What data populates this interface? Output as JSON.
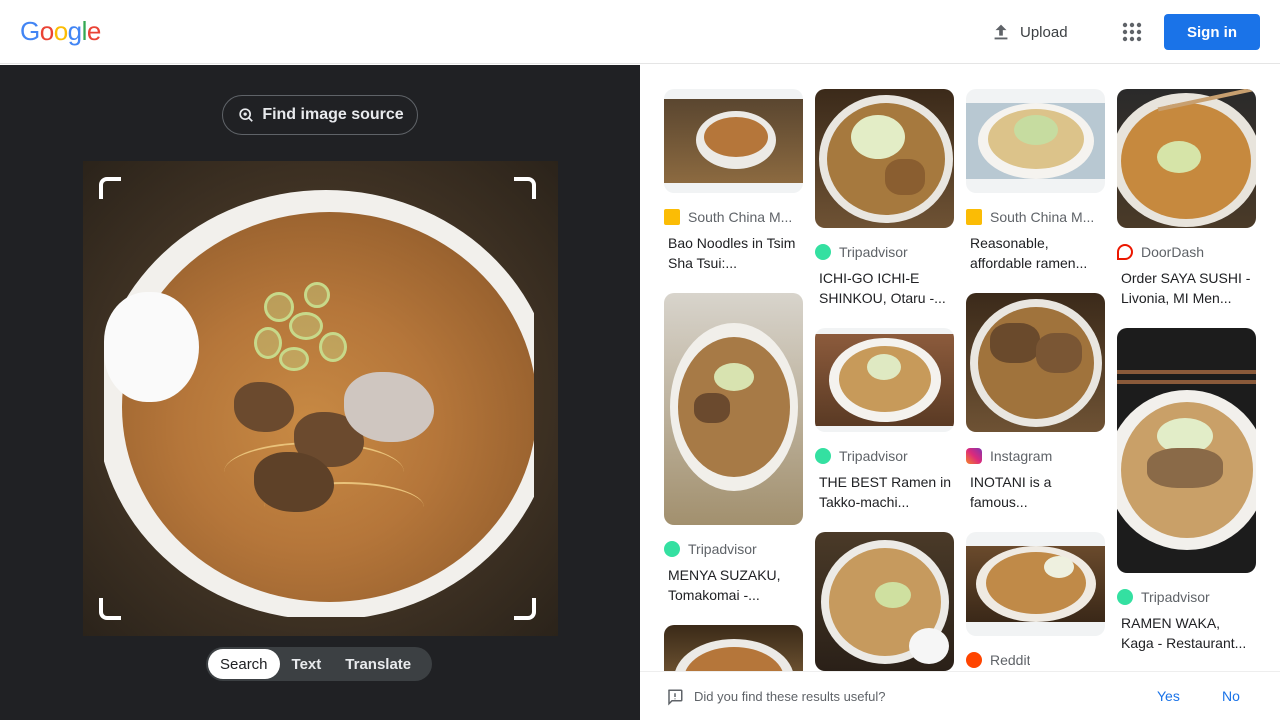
{
  "header": {
    "logo_letters": [
      "G",
      "o",
      "o",
      "g",
      "l",
      "e"
    ],
    "upload_label": "Upload",
    "apps_icon": "apps-grid-icon",
    "signin_label": "Sign in"
  },
  "colors": {
    "google_blue": "#4285f4",
    "google_red": "#ea4335",
    "google_yellow": "#fbbc05",
    "google_green": "#34a853",
    "signin_bg": "#1a73e8",
    "left_panel_bg": "#202124"
  },
  "lens": {
    "find_source_label": "Find image source",
    "modes": [
      "Search",
      "Text",
      "Translate"
    ],
    "active_mode": "Search"
  },
  "results": {
    "columns": [
      [
        {
          "source": "South China M...",
          "title": "Bao Noodles in Tsim Sha Tsui:...",
          "icon": "scmp-icon"
        },
        {
          "source": "Tripadvisor",
          "title": "MENYA SUZAKU, Tomakomai -...",
          "icon": "tripadvisor-icon"
        },
        {
          "source": "",
          "title": "",
          "icon": ""
        }
      ],
      [
        {
          "source": "Tripadvisor",
          "title": "ICHI-GO ICHI-E SHINKOU, Otaru -...",
          "icon": "tripadvisor-icon"
        },
        {
          "source": "Tripadvisor",
          "title": "THE BEST Ramen in Takko-machi...",
          "icon": "tripadvisor-icon"
        },
        {
          "source": "",
          "title": "",
          "icon": ""
        }
      ],
      [
        {
          "source": "South China M...",
          "title": "Reasonable, affordable ramen...",
          "icon": "scmp-icon"
        },
        {
          "source": "Instagram",
          "title": "INOTANI is a famous...",
          "icon": "instagram-icon"
        },
        {
          "source": "Reddit",
          "title": "",
          "icon": "reddit-icon"
        }
      ],
      [
        {
          "source": "DoorDash",
          "title": "Order SAYA SUSHI - Livonia, MI Men...",
          "icon": "doordash-icon"
        },
        {
          "source": "Tripadvisor",
          "title": "RAMEN WAKA, Kaga - Restaurant...",
          "icon": "tripadvisor-icon"
        }
      ]
    ]
  },
  "feedback": {
    "question": "Did you find these results useful?",
    "yes": "Yes",
    "no": "No"
  }
}
